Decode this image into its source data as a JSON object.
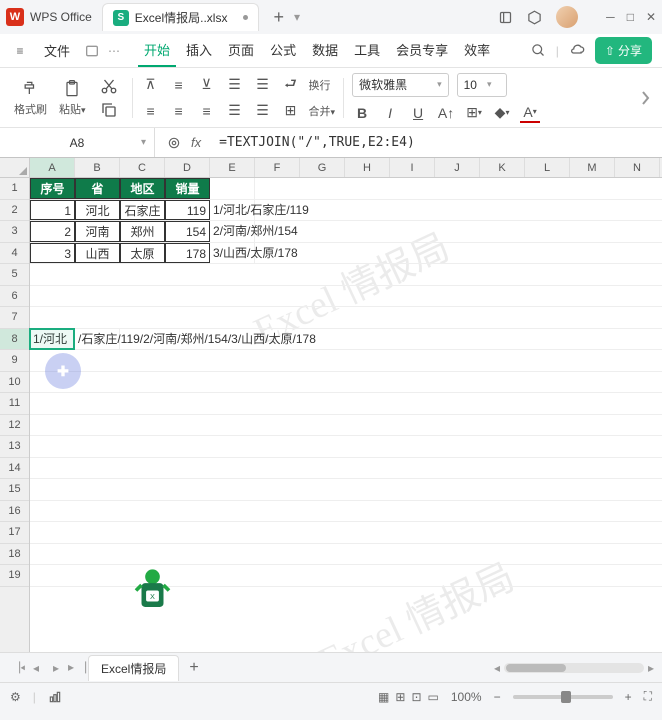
{
  "app": {
    "name": "WPS Office"
  },
  "document": {
    "tab_icon": "S",
    "name": "Excel情报局..xlsx"
  },
  "menu": {
    "file": "文件",
    "tabs": [
      "开始",
      "插入",
      "页面",
      "公式",
      "数据",
      "工具",
      "会员专享",
      "效率"
    ],
    "active_tab": 0
  },
  "share_button": "分享",
  "toolbar": {
    "format_painter": "格式刷",
    "paste": "粘贴",
    "wrap": "换行",
    "merge": "合并",
    "font_name": "微软雅黑",
    "font_size": "10"
  },
  "name_box": "A8",
  "formula": "=TEXTJOIN(\"/\",TRUE,E2:E4)",
  "columns": [
    "A",
    "B",
    "C",
    "D",
    "E",
    "F",
    "G",
    "H",
    "I",
    "J",
    "K",
    "L",
    "M",
    "N"
  ],
  "rows": [
    "1",
    "2",
    "3",
    "4",
    "5",
    "6",
    "7",
    "8",
    "9",
    "10",
    "11",
    "12",
    "13",
    "14",
    "15",
    "16",
    "17",
    "18",
    "19"
  ],
  "table": {
    "headers": [
      "序号",
      "省",
      "地区",
      "销量"
    ],
    "data": [
      [
        "1",
        "河北",
        "石家庄",
        "119",
        "1/河北/石家庄/119"
      ],
      [
        "2",
        "河南",
        "郑州",
        "154",
        "2/河南/郑州/154"
      ],
      [
        "3",
        "山西",
        "太原",
        "178",
        "3/山西/太原/178"
      ]
    ]
  },
  "row8": {
    "a": "1/河北",
    "rest": "/石家庄/119/2/河南/郑州/154/3/山西/太原/178"
  },
  "watermark": "Excel 情报局",
  "sheet_tab": "Excel情报局",
  "zoom": "100%",
  "chart_data": null
}
